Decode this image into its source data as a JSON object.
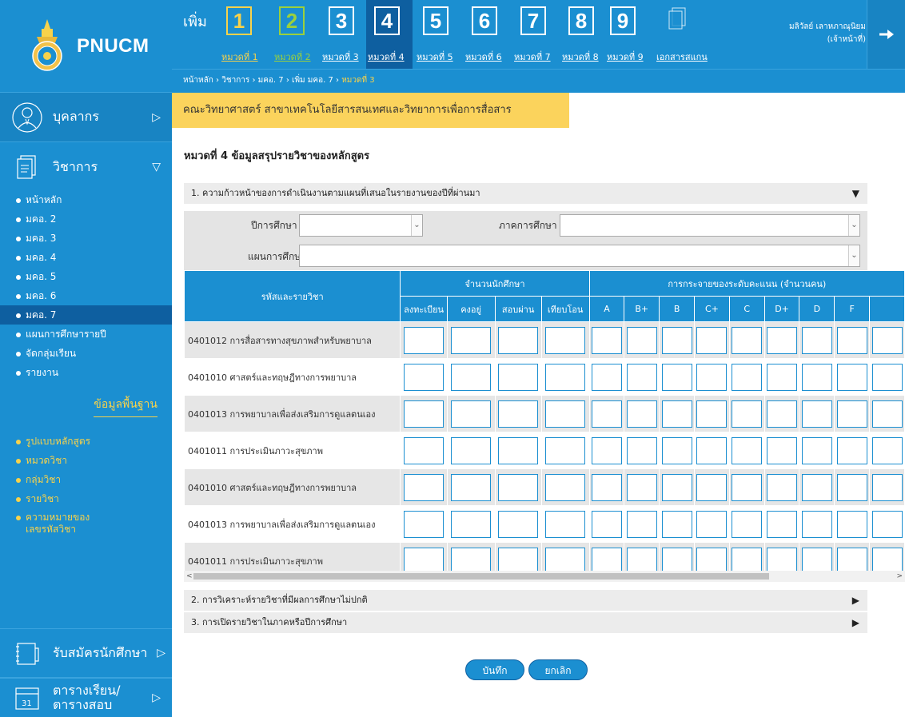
{
  "brand": {
    "name": "PNUCM"
  },
  "sidebar": {
    "personnel": {
      "label": "บุคลากร"
    },
    "academic": {
      "label": "วิชาการ"
    },
    "academic_items": [
      {
        "label": "หน้าหลัก"
      },
      {
        "label": "มคอ. 2"
      },
      {
        "label": "มคอ. 3"
      },
      {
        "label": "มคอ. 4"
      },
      {
        "label": "มคอ. 5"
      },
      {
        "label": "มคอ. 6"
      },
      {
        "label": "มคอ. 7"
      },
      {
        "label": "แผนการศึกษารายปี"
      },
      {
        "label": "จัดกลุ่มเรียน"
      },
      {
        "label": "รายงาน"
      }
    ],
    "basic_data": {
      "label": "ข้อมูลพื้นฐาน"
    },
    "basic_items": [
      {
        "label": "รูปแบบหลักสูตร"
      },
      {
        "label": "หมวดวิชา"
      },
      {
        "label": "กลุ่มวิชา"
      },
      {
        "label": "รายวิชา"
      },
      {
        "label": "ความหมายของ",
        "label2": "เลขรหัสวิชา"
      }
    ],
    "admission": {
      "label": "รับสมัครนักศึกษา"
    },
    "schedule": {
      "label": "ตารางเรียน/",
      "label2": "ตารางสอบ"
    }
  },
  "header": {
    "add_label": "เพิ่ม",
    "steps": [
      {
        "num": "1",
        "label": "หมวดที่ 1"
      },
      {
        "num": "2",
        "label": "หมวดที่ 2"
      },
      {
        "num": "3",
        "label": "หมวดที่ 3"
      },
      {
        "num": "4",
        "label": "หมวดที่ 4"
      },
      {
        "num": "5",
        "label": "หมวดที่ 5"
      },
      {
        "num": "6",
        "label": "หมวดที่ 6"
      },
      {
        "num": "7",
        "label": "หมวดที่ 7"
      },
      {
        "num": "8",
        "label": "หมวดที่ 8"
      },
      {
        "num": "9",
        "label": "หมวดที่ 9"
      }
    ],
    "scan_doc_label": "เอกสารสแกน",
    "user_name": "มลิวัลย์ เลาหภาณุนิยม",
    "user_role": "(เจ้าหน้าที่)",
    "breadcrumb": [
      "หน้าหลัก",
      "วิชาการ",
      "มคอ. 7",
      "เพิ่ม มคอ. 7",
      "หมวดที่ 3"
    ],
    "breadcrumb_sep": "›"
  },
  "main": {
    "faculty": "คณะวิทยาศาสตร์ สาขาเทคโนโลยีสารสนเทศและวิทยาการเพื่อการสื่อสาร",
    "page_title": "หมวดที่ 4 ข้อมูลสรุปรายวิชาของหลักสูตร",
    "section1": "1. ความก้าวหน้าของการดำเนินงานตามแผนที่เสนอในรายงานของปีที่ผ่านมา",
    "section2": "2. การวิเคราะห์รายวิชาที่มีผลการศึกษาไม่ปกติ",
    "section3": "3. การเปิดรายวิชาในภาคหรือปีการศึกษา",
    "filters": {
      "year_label": "ปีการศึกษา",
      "term_label": "ภาคการศึกษา",
      "plan_label": "แผนการศึกษา",
      "year_value": "",
      "term_value": "",
      "plan_value": ""
    },
    "table": {
      "course_header": "รหัสและรายวิชา",
      "students_header": "จำนวนนักศึกษา",
      "grades_header": "การกระจายของระดับคะแนน (จำนวนคน)",
      "student_cols": [
        "ลงทะเบียน",
        "คงอยู่",
        "สอบผ่าน",
        "เทียบโอน"
      ],
      "grade_cols": [
        "A",
        "B+",
        "B",
        "C+",
        "C",
        "D+",
        "D",
        "F",
        ""
      ],
      "rows": [
        "0401012 การสื่อสารทางสุขภาพสำหรับพยาบาล",
        "0401010 ศาสตร์และทฤษฎีทางการพยาบาล",
        "0401013 การพยาบาลเพื่อส่งเสริมการดูแลตนเอง",
        "0401011 การประเมินภาวะสุขภาพ",
        "0401010 ศาสตร์และทฤษฎีทางการพยาบาล",
        "0401013 การพยาบาลเพื่อส่งเสริมการดูแลตนเอง",
        "0401011 การประเมินภาวะสุขภาพ"
      ]
    },
    "save_label": "บันทึก",
    "cancel_label": "ยกเลิก"
  },
  "colors": {
    "primary": "#1b8fd1",
    "dark": "#0e5fa0",
    "accent_yellow": "#fbd35c",
    "green": "#9bd03c"
  }
}
